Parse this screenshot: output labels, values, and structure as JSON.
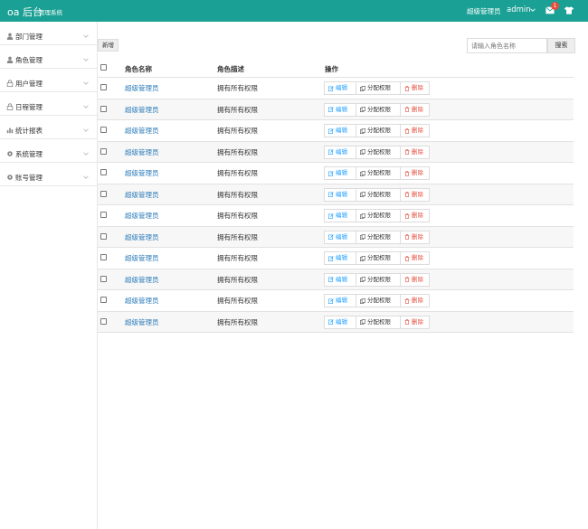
{
  "header": {
    "logo": "oa 后台",
    "subtitle": "管理系统",
    "user_role": "超级管理员",
    "username": "admin",
    "mail_badge": "1"
  },
  "sidebar": {
    "items": [
      {
        "label": "部门管理",
        "icon": "person-icon"
      },
      {
        "label": "角色管理",
        "icon": "person-icon"
      },
      {
        "label": "用户管理",
        "icon": "lock-icon"
      },
      {
        "label": "日程管理",
        "icon": "lock-icon"
      },
      {
        "label": "统计报表",
        "icon": "chart-icon"
      },
      {
        "label": "系统管理",
        "icon": "gear-icon"
      },
      {
        "label": "账号管理",
        "icon": "gear-icon"
      }
    ]
  },
  "toolbar": {
    "add_label": "新增",
    "search_placeholder": "请输入角色名称",
    "search_label": "搜索"
  },
  "table": {
    "headers": {
      "name": "角色名称",
      "desc": "角色描述",
      "actions": "操作"
    },
    "actions": {
      "edit": "编辑",
      "assign": "分配权限",
      "delete": "删除"
    },
    "rows": [
      {
        "name": "超级管理员",
        "desc": "拥有所有权限"
      },
      {
        "name": "超级管理员",
        "desc": "拥有所有权限"
      },
      {
        "name": "超级管理员",
        "desc": "拥有所有权限"
      },
      {
        "name": "超级管理员",
        "desc": "拥有所有权限"
      },
      {
        "name": "超级管理员",
        "desc": "拥有所有权限"
      },
      {
        "name": "超级管理员",
        "desc": "拥有所有权限"
      },
      {
        "name": "超级管理员",
        "desc": "拥有所有权限"
      },
      {
        "name": "超级管理员",
        "desc": "拥有所有权限"
      },
      {
        "name": "超级管理员",
        "desc": "拥有所有权限"
      },
      {
        "name": "超级管理员",
        "desc": "拥有所有权限"
      },
      {
        "name": "超级管理员",
        "desc": "拥有所有权限"
      },
      {
        "name": "超级管理员",
        "desc": "拥有所有权限"
      }
    ]
  },
  "colors": {
    "header_bg": "#1aa094",
    "link": "#2a7ab8",
    "edit": "#1e9fff",
    "delete": "#e74c3c",
    "badge": "#e74c3c"
  }
}
